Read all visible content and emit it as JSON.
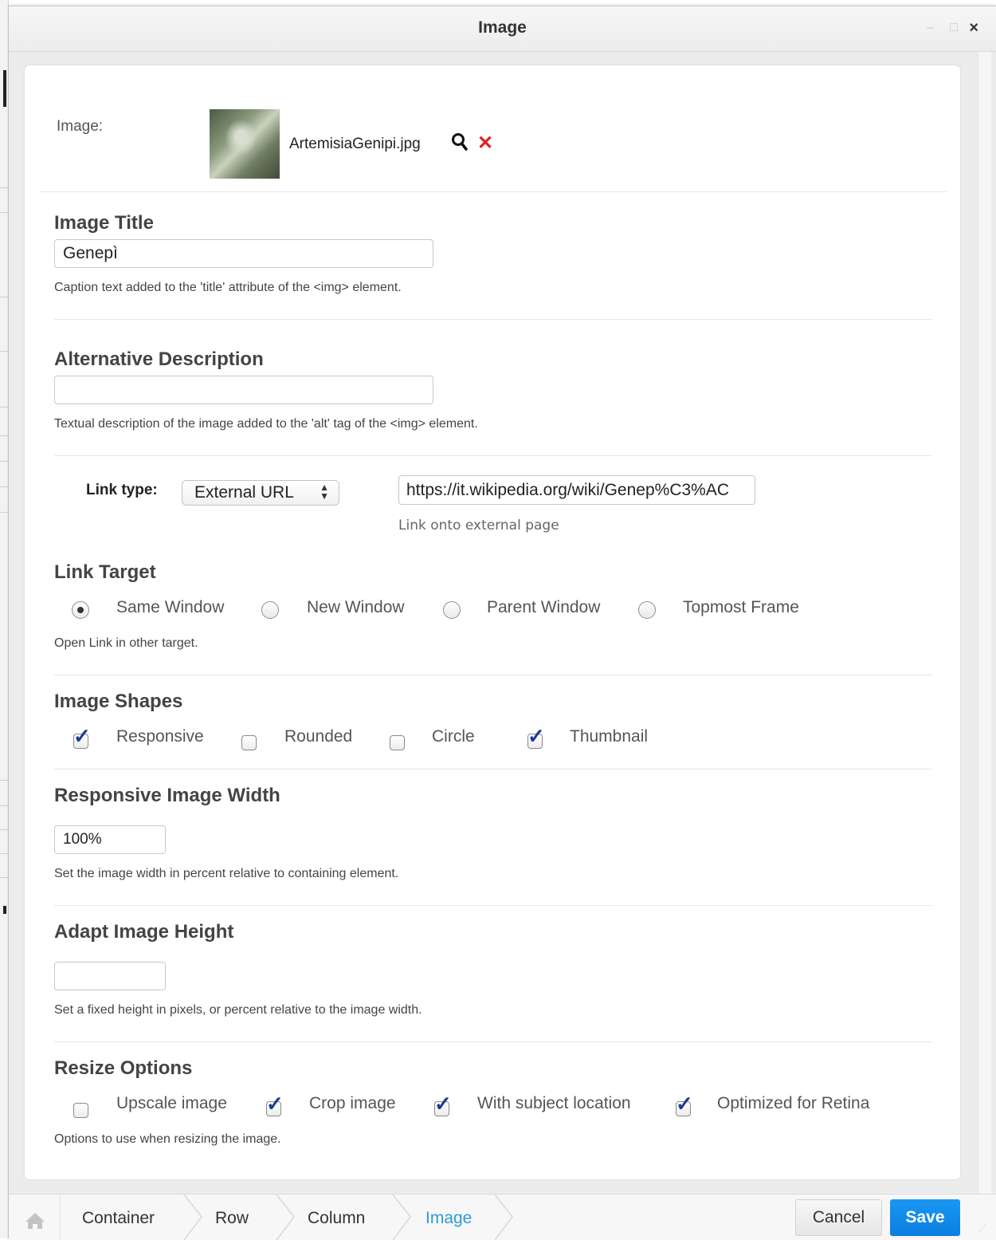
{
  "window": {
    "title": "Image",
    "minimize_icon": "minimize-icon",
    "maximize_icon": "maximize-icon",
    "close_icon": "close-icon",
    "close_glyph": "×"
  },
  "image_row": {
    "label": "Image:",
    "filename": "ArtemisiaGenipi.jpg",
    "search_icon": "search-icon",
    "remove_icon": "remove-icon"
  },
  "image_title": {
    "heading": "Image Title",
    "value": "Genepì",
    "help": "Caption text added to the 'title' attribute of the <img> element."
  },
  "alt_description": {
    "heading": "Alternative Description",
    "value": "",
    "help": "Textual description of the image added to the 'alt' tag of the <img> element."
  },
  "link": {
    "type_label": "Link type:",
    "type_value": "External URL",
    "url_value": "https://it.wikipedia.org/wiki/Genep%C3%AC",
    "url_help": "Link onto external page"
  },
  "link_target": {
    "heading": "Link Target",
    "options": [
      {
        "label": "Same Window",
        "selected": true
      },
      {
        "label": "New Window",
        "selected": false
      },
      {
        "label": "Parent Window",
        "selected": false
      },
      {
        "label": "Topmost Frame",
        "selected": false
      }
    ],
    "help": "Open Link in other target."
  },
  "image_shapes": {
    "heading": "Image Shapes",
    "options": [
      {
        "label": "Responsive",
        "checked": true
      },
      {
        "label": "Rounded",
        "checked": false
      },
      {
        "label": "Circle",
        "checked": false
      },
      {
        "label": "Thumbnail",
        "checked": true
      }
    ]
  },
  "responsive_width": {
    "heading": "Responsive Image Width",
    "value": "100%",
    "help": "Set the image width in percent relative to containing element."
  },
  "adapt_height": {
    "heading": "Adapt Image Height",
    "value": "",
    "help": "Set a fixed height in pixels, or percent relative to the image width."
  },
  "resize_options": {
    "heading": "Resize Options",
    "options": [
      {
        "label": "Upscale image",
        "checked": false
      },
      {
        "label": "Crop image",
        "checked": true
      },
      {
        "label": "With subject location",
        "checked": true
      },
      {
        "label": "Optimized for Retina",
        "checked": true
      }
    ],
    "help": "Options to use when resizing the image."
  },
  "breadcrumb": {
    "home_icon": "home-icon",
    "items": [
      "Container",
      "Row",
      "Column",
      "Image"
    ],
    "active": "Image"
  },
  "actions": {
    "cancel": "Cancel",
    "save": "Save"
  },
  "colors": {
    "accent": "#0a7fe0",
    "active_crumb": "#2e9ad8",
    "remove": "#e02020",
    "check": "#1d3b8f"
  }
}
